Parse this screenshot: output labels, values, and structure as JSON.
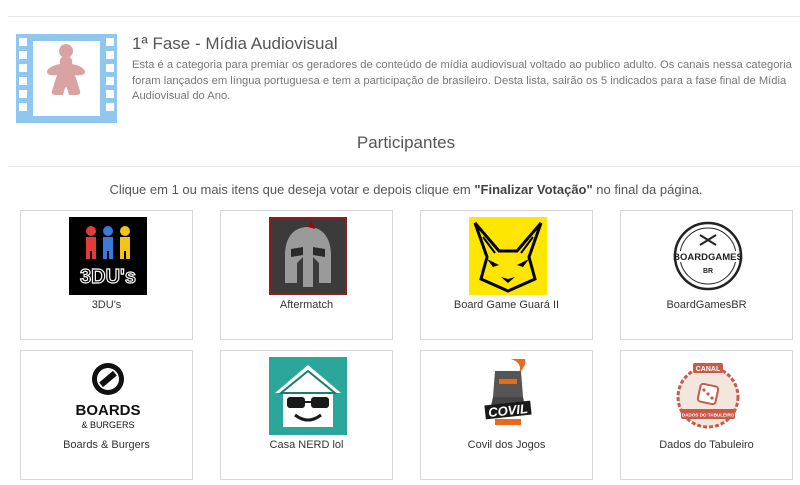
{
  "category": {
    "title": "1ª Fase - Mídia Audiovisual",
    "description": "Esta é a categoria para premiar os geradores de conteúdo de mídia audiovisual voltado ao publico adulto. Os canais nessa categoria foram lançados em língua portuguesa e tem a participação de brasileiro. Desta lista, sairão os 5 indicados para a fase final de Mídia Audiovisual do Ano.",
    "icon": "film-strip-meeple-icon"
  },
  "section": {
    "title": "Participantes",
    "instructions_before": "Clique em 1 ou mais itens que deseja votar e depois clique em ",
    "instructions_emphasis": "\"Finalizar Votação\"",
    "instructions_after": " no final da página."
  },
  "participants": [
    {
      "name": "3DU's",
      "logo_text": "3DU's",
      "logo": "3dus-logo"
    },
    {
      "name": "Aftermatch",
      "logo": "spartan-helmet-logo"
    },
    {
      "name": "Board Game Guará II",
      "logo": "yellow-fox-logo"
    },
    {
      "name": "BoardGamesBR",
      "logo_text": "BOARDGAMES",
      "logo_subtext": "BR",
      "logo": "boardgamesbr-badge-logo"
    },
    {
      "name": "Boards & Burgers",
      "logo_text": "BOARDS",
      "logo_subtext": "& BURGERS",
      "logo": "boards-burgers-logo"
    },
    {
      "name": "Casa NERD lol",
      "logo": "nerd-house-logo"
    },
    {
      "name": "Covil dos Jogos",
      "logo_text": "COVIL",
      "logo": "covil-knight-logo"
    },
    {
      "name": "Dados do Tabuleiro",
      "logo_text": "CANAL",
      "logo_subtext": "DADOS DO TABULEIRO",
      "logo": "dados-tabuleiro-logo"
    }
  ]
}
